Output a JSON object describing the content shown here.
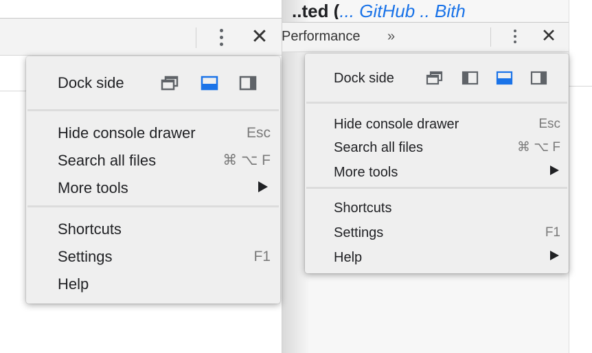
{
  "left_menu": {
    "dock_side_label": "Dock side",
    "items": [
      {
        "label": "Hide console drawer",
        "shortcut": "Esc"
      },
      {
        "label": "Search all files",
        "shortcut": "⌘ ⌥ F"
      },
      {
        "label": "More tools",
        "submenu": true
      }
    ],
    "items2": [
      {
        "label": "Shortcuts"
      },
      {
        "label": "Settings",
        "shortcut": "F1"
      },
      {
        "label": "Help"
      }
    ],
    "dock_icons": [
      "undock-icon",
      "dock-bottom-icon",
      "dock-right-icon"
    ],
    "selected_dock": "dock-bottom-icon"
  },
  "right_panel": {
    "tab_label": "Performance",
    "overflow_label": "»",
    "header_bold": "..ted (",
    "header_link": "... GitHub .. Bith",
    "close_label": "✕"
  },
  "right_menu": {
    "dock_side_label": "Dock side",
    "items": [
      {
        "label": "Hide console drawer",
        "shortcut": "Esc"
      },
      {
        "label": "Search all files",
        "shortcut": "⌘ ⌥ F"
      },
      {
        "label": "More tools",
        "submenu": true
      }
    ],
    "items2": [
      {
        "label": "Shortcuts"
      },
      {
        "label": "Settings",
        "shortcut": "F1"
      },
      {
        "label": "Help",
        "submenu": true
      }
    ],
    "dock_icons": [
      "undock-icon",
      "dock-left-icon",
      "dock-bottom-icon",
      "dock-right-icon"
    ],
    "selected_dock": "dock-bottom-icon"
  },
  "left_toolbar": {
    "close_label": "✕"
  },
  "colors": {
    "accent": "#1a73e8",
    "menu_bg": "#efefef",
    "icon_gray": "#5f6368"
  }
}
